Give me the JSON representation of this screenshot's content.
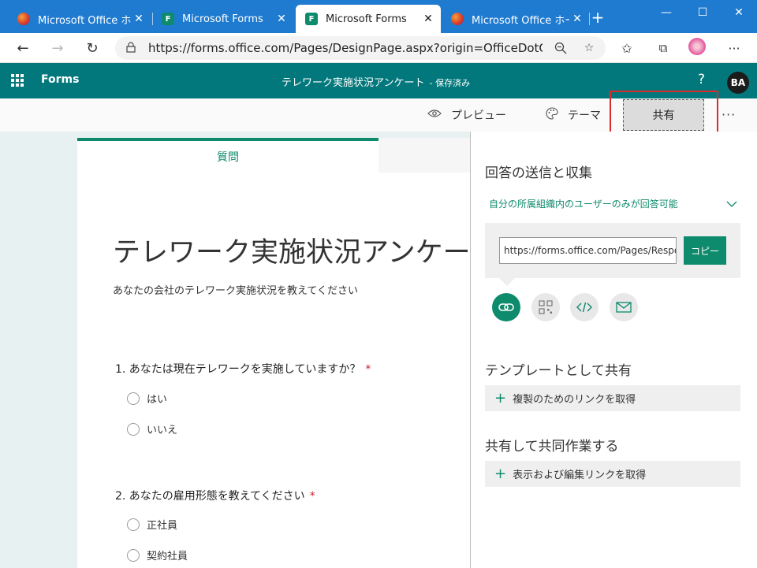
{
  "browser": {
    "tabs": [
      {
        "title": "Microsoft Office ホーム",
        "icon": "office-icon"
      },
      {
        "title": "Microsoft Forms",
        "icon": "forms-icon"
      },
      {
        "title": "Microsoft Forms",
        "icon": "forms-icon",
        "active": true
      },
      {
        "title": "Microsoft Office ホーム",
        "icon": "office-icon"
      }
    ],
    "url": "https://forms.office.com/Pages/DesignPage.aspx?origin=OfficeDotC..."
  },
  "app": {
    "name": "Forms",
    "doc_title": "テレワーク実施状況アンケート",
    "saved_status": "- 保存済み",
    "help": "?",
    "user_initials": "BA"
  },
  "commands": {
    "preview": "プレビュー",
    "theme": "テーマ",
    "share": "共有",
    "more": "···"
  },
  "form": {
    "tab_label": "質問",
    "title": "テレワーク実施状況アンケート",
    "description": "あなたの会社のテレワーク実施状況を教えてください",
    "questions": [
      {
        "text": "1. あなたは現在テレワークを実施していますか？",
        "required": "*",
        "options": [
          "はい",
          "いいえ"
        ]
      },
      {
        "text": "2. あなたの雇用形態を教えてください",
        "required": "*",
        "options": [
          "正社員",
          "契約社員"
        ]
      }
    ]
  },
  "share_panel": {
    "heading": "回答の送信と収集",
    "audience": "自分の所属組織内のユーザーのみが回答可能",
    "link_value": "https://forms.office.com/Pages/ResponsePage.aspx",
    "copy_label": "コピー",
    "share_icons": [
      "link-icon",
      "qr-code-icon",
      "embed-icon",
      "email-icon"
    ],
    "template_heading": "テンプレートとして共有",
    "template_action": "複製のためのリンクを取得",
    "collab_heading": "共有して共同作業する",
    "collab_action": "表示および編集リンクを取得"
  },
  "colors": {
    "browser_blue": "#1f7bd0",
    "forms_teal": "#03787c",
    "accent_green": "#0e8a6c",
    "highlight_red": "#d92b2b",
    "required_red": "#c4262e"
  }
}
